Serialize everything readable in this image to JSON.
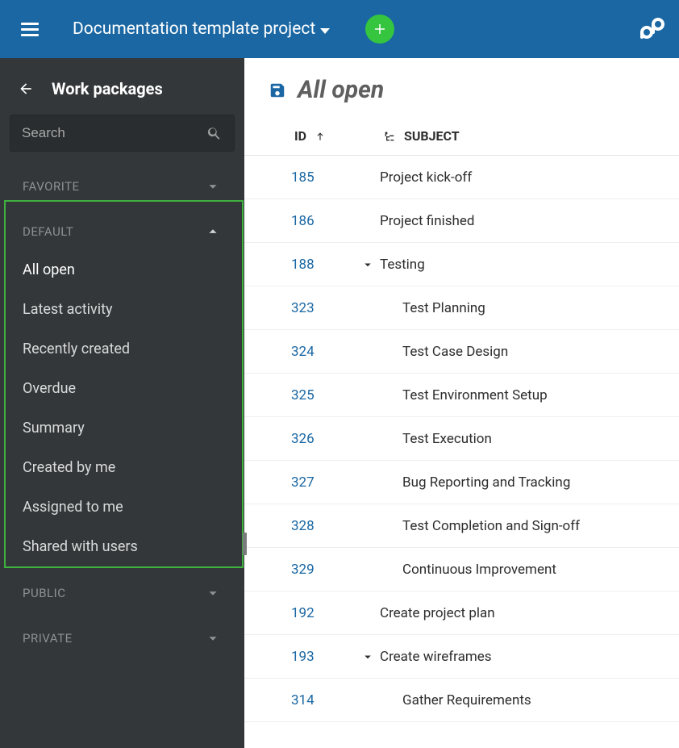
{
  "topbar": {
    "project_title": "Documentation template project"
  },
  "sidebar": {
    "title": "Work packages",
    "search_placeholder": "Search",
    "sections": {
      "favorite": "FAVORITE",
      "default": "DEFAULT",
      "public": "PUBLIC",
      "private": "PRIVATE"
    },
    "default_items": [
      "All open",
      "Latest activity",
      "Recently created",
      "Overdue",
      "Summary",
      "Created by me",
      "Assigned to me",
      "Shared with users"
    ]
  },
  "main": {
    "view_title": "All open",
    "columns": {
      "id": "ID",
      "subject": "SUBJECT"
    },
    "rows": [
      {
        "id": "185",
        "subject": "Project kick-off",
        "indent": 0,
        "toggle": false
      },
      {
        "id": "186",
        "subject": "Project finished",
        "indent": 0,
        "toggle": false
      },
      {
        "id": "188",
        "subject": "Testing",
        "indent": 0,
        "toggle": true
      },
      {
        "id": "323",
        "subject": "Test Planning",
        "indent": 1,
        "toggle": false
      },
      {
        "id": "324",
        "subject": "Test Case Design",
        "indent": 1,
        "toggle": false
      },
      {
        "id": "325",
        "subject": "Test Environment Setup",
        "indent": 1,
        "toggle": false
      },
      {
        "id": "326",
        "subject": "Test Execution",
        "indent": 1,
        "toggle": false
      },
      {
        "id": "327",
        "subject": "Bug Reporting and Tracking",
        "indent": 1,
        "toggle": false
      },
      {
        "id": "328",
        "subject": "Test Completion and Sign-off",
        "indent": 1,
        "toggle": false
      },
      {
        "id": "329",
        "subject": "Continuous Improvement",
        "indent": 1,
        "toggle": false
      },
      {
        "id": "192",
        "subject": "Create project plan",
        "indent": 0,
        "toggle": false
      },
      {
        "id": "193",
        "subject": "Create wireframes",
        "indent": 0,
        "toggle": true
      },
      {
        "id": "314",
        "subject": "Gather Requirements",
        "indent": 1,
        "toggle": false
      }
    ]
  }
}
